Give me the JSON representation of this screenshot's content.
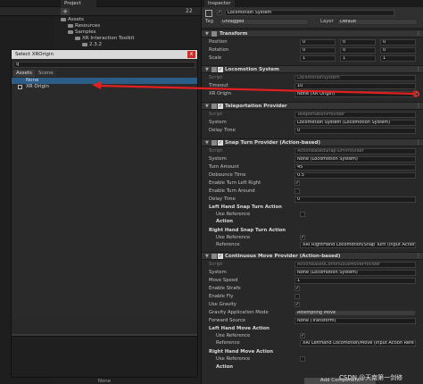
{
  "project_panel": {
    "tab": "Project",
    "counter": "22",
    "tree": [
      "Assets",
      "Resources",
      "Samples",
      "XR Interaction Toolkit",
      "2.3.2"
    ]
  },
  "dialog": {
    "title": "Select XROrigin",
    "close": "x",
    "search_value": "q",
    "tabs": [
      "Assets",
      "Scene"
    ],
    "items": [
      {
        "label": "None",
        "selected": true
      },
      {
        "label": "XR Origin",
        "selected": false
      }
    ],
    "preview_label": "None"
  },
  "inspector": {
    "tab": "Inspector",
    "object_name": "Locomotion System",
    "tag_label": "Tag",
    "tag_value": "Untagged",
    "layer_label": "Layer",
    "layer_value": "Default",
    "transform": {
      "title": "Transform",
      "rows": [
        {
          "label": "Position",
          "x": "0",
          "y": "0",
          "z": "0"
        },
        {
          "label": "Rotation",
          "x": "0",
          "y": "0",
          "z": "0"
        },
        {
          "label": "Scale",
          "x": "1",
          "y": "1",
          "z": "1"
        }
      ]
    },
    "locomotion_system": {
      "title": "Locomotion System",
      "script_label": "Script",
      "script_value": "LocomotionSystem",
      "timeout_label": "Timeout",
      "timeout_value": "10",
      "xr_origin_label": "XR Origin",
      "xr_origin_value": "None (XR Origin)"
    },
    "teleport": {
      "title": "Teleportation Provider",
      "script_label": "Script",
      "script_value": "TeleportationProvider",
      "system_label": "System",
      "system_value": "Locomotion System (Locomotion System)",
      "delay_label": "Delay Time",
      "delay_value": "0"
    },
    "snap_turn": {
      "title": "Snap Turn Provider (Action-based)",
      "script_label": "Script",
      "script_value": "ActionBasedSnapTurnProvider",
      "system_label": "System",
      "system_value": "None (Locomotion System)",
      "turn_amount_label": "Turn Amount",
      "turn_amount_value": "45",
      "debounce_label": "Debounce Time",
      "debounce_value": "0.5",
      "left_right_label": "Enable Turn Left Right",
      "around_label": "Enable Turn Around",
      "delay_label": "Delay Time",
      "delay_value": "0",
      "left_hand_label": "Left Hand Snap Turn Action",
      "use_reference_label": "Use Reference",
      "action_label": "Action",
      "right_hand_label": "Right Hand Snap Turn Action",
      "reference_label": "Reference",
      "right_reference_value": "XRI RightHand Locomotion/Snap Turn (Input Action"
    },
    "move": {
      "title": "Continuous Move Provider (Action-based)",
      "script_label": "Script",
      "script_value": "ActionBasedContinuousMoveProvider",
      "system_label": "System",
      "system_value": "None (Locomotion System)",
      "speed_label": "Move Speed",
      "speed_value": "1",
      "strafe_label": "Enable Strafe",
      "fly_label": "Enable Fly",
      "gravity_label": "Use Gravity",
      "gravity_mode_label": "Gravity Application Mode",
      "gravity_mode_value": "Attempting Move",
      "forward_label": "Forward Source",
      "forward_value": "None (Transform)",
      "left_hand_label": "Left Hand Move Action",
      "use_reference_label": "Use Reference",
      "reference_label": "Reference",
      "left_reference_value": "XRI LeftHand Locomotion/Move (Input Action Refe",
      "right_hand_label": "Right Hand Move Action",
      "action_label": "Action"
    },
    "add_component": "Add Component"
  },
  "watermark": "CSDN @天南第一剑修",
  "colors": {
    "annotation_arrow": "#e02020",
    "selection": "#2c5d87"
  }
}
